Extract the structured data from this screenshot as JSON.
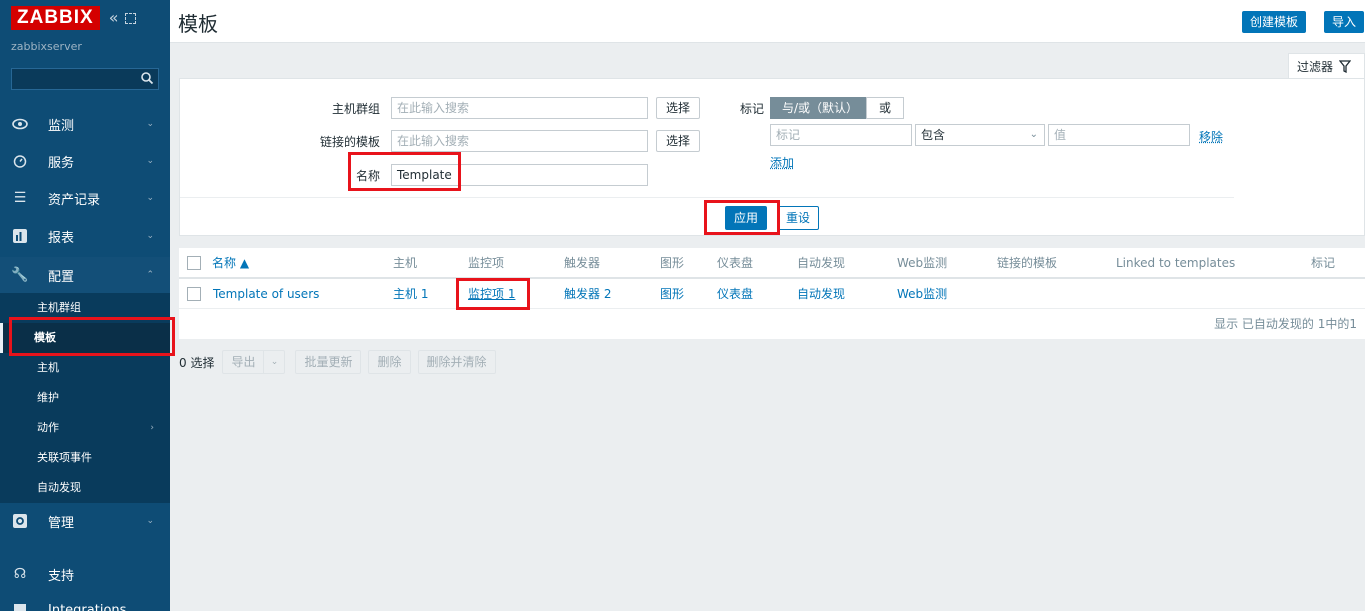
{
  "sidebar": {
    "logo": "ZABBIX",
    "server_name": "zabbixserver",
    "search_placeholder": "",
    "menu": [
      {
        "label": "监测",
        "icon": "eye-icon"
      },
      {
        "label": "服务",
        "icon": "clock-icon"
      },
      {
        "label": "资产记录",
        "icon": "list-icon"
      },
      {
        "label": "报表",
        "icon": "bar-chart-icon"
      },
      {
        "label": "配置",
        "icon": "wrench-icon"
      },
      {
        "label": "管理",
        "icon": "gear-icon"
      },
      {
        "label": "支持",
        "icon": "headset-icon"
      },
      {
        "label": "Integrations",
        "icon": "integrations-icon"
      }
    ],
    "submenu": [
      {
        "label": "主机群组"
      },
      {
        "label": "模板"
      },
      {
        "label": "主机"
      },
      {
        "label": "维护"
      },
      {
        "label": "动作"
      },
      {
        "label": "关联项事件"
      },
      {
        "label": "自动发现"
      }
    ]
  },
  "header": {
    "title": "模板",
    "create_button": "创建模板",
    "import_button": "导入"
  },
  "filter": {
    "tab_label": "过滤器",
    "host_groups_label": "主机群组",
    "host_groups_placeholder": "在此输入搜索",
    "linked_templates_label": "链接的模板",
    "linked_templates_placeholder": "在此输入搜索",
    "select_label": "选择",
    "name_label": "名称",
    "name_value": "Template",
    "tags_label": "标记",
    "and_or_label": "与/或（默认）",
    "or_label": "或",
    "tag_placeholder": "标记",
    "operator_value": "包含",
    "value_placeholder": "值",
    "remove_label": "移除",
    "add_label": "添加",
    "apply_label": "应用",
    "reset_label": "重设"
  },
  "table": {
    "columns": [
      "名称 ▲",
      "主机",
      "监控项",
      "触发器",
      "图形",
      "仪表盘",
      "自动发现",
      "Web监测",
      "链接的模板",
      "Linked to templates",
      "标记"
    ],
    "rows": [
      {
        "name": "Template of users",
        "hosts": "主机 1",
        "items": "监控项 1",
        "triggers": "触发器 2",
        "graphs": "图形",
        "dashboards": "仪表盘",
        "discovery": "自动发现",
        "web": "Web监测"
      }
    ],
    "footer": "显示 已自动发现的 1中的1"
  },
  "actions": {
    "selected": "0 选择",
    "export": "导出",
    "mass_update": "批量更新",
    "delete": "删除",
    "delete_clear": "删除并清除"
  },
  "colors": {
    "sidebar_bg": "#0e4c75",
    "accent": "#0275b8",
    "logo_red": "#d40000",
    "highlight": "#e8131b"
  }
}
